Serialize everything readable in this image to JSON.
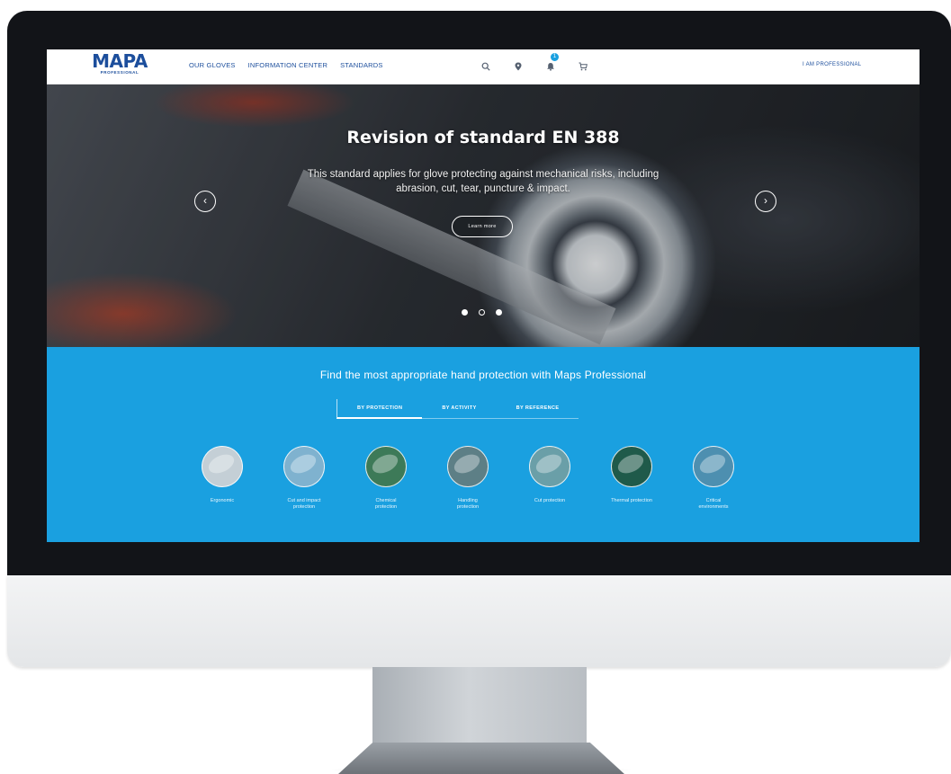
{
  "navbar": {
    "logo": "MAPA",
    "logo_sub": "PROFESSIONAL",
    "links": [
      "OUR GLOVES",
      "INFORMATION CENTER",
      "STANDARDS"
    ],
    "icons": [
      "search-icon",
      "location-icon",
      "bell-icon",
      "cart-icon"
    ],
    "notification_count": "1",
    "user_label": "I AM PROFESSIONAL"
  },
  "hero": {
    "title": "Revision of standard EN 388",
    "description": "This standard applies for glove protecting against mechanical risks, including abrasion, cut, tear, puncture & impact.",
    "button": "Learn more",
    "prev_symbol": "‹",
    "next_symbol": "›",
    "slides": 3,
    "active_slide": 1
  },
  "finder": {
    "heading": "Find the most appropriate hand protection with Maps Professional",
    "tabs": [
      "BY PROTECTION",
      "BY ACTIVITY",
      "BY REFERENCE"
    ],
    "active_tab": 0,
    "categories": [
      {
        "label": "Ergonomic",
        "color": "#c4cfd6"
      },
      {
        "label": "Cut and impact protection",
        "color": "#7fb2cf"
      },
      {
        "label": "Chemical protection",
        "color": "#3d7a58"
      },
      {
        "label": "Handling protection",
        "color": "#5d7f86"
      },
      {
        "label": "Cut protection",
        "color": "#6a9fa8"
      },
      {
        "label": "Thermal protection",
        "color": "#1f5a4a"
      },
      {
        "label": "Critical environments",
        "color": "#4d8fb0"
      }
    ]
  },
  "colors": {
    "brand": "#1c4e9c",
    "band": "#1aa0e0",
    "bezel": "#121418"
  }
}
